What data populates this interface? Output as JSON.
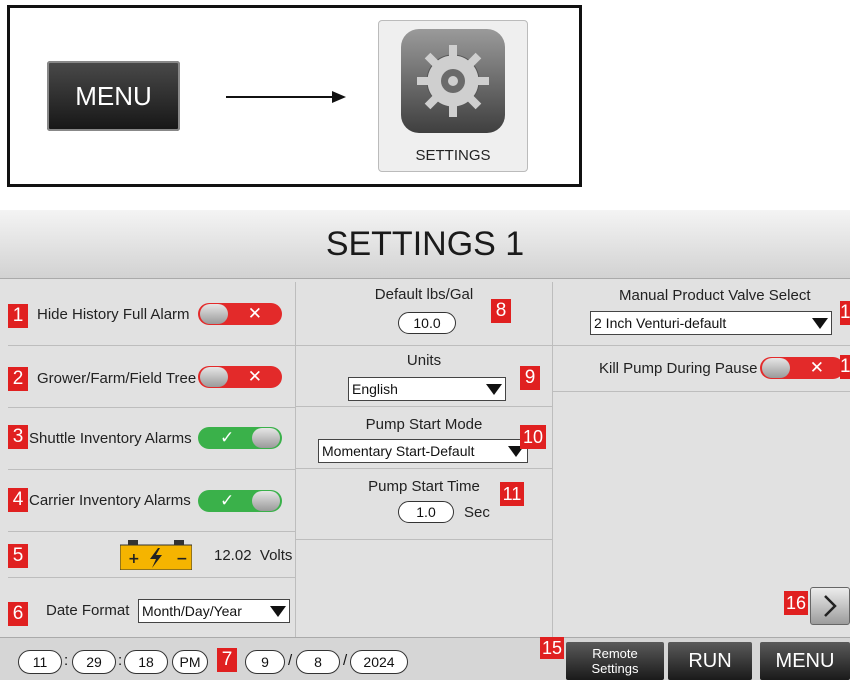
{
  "instruction": {
    "menu_label": "MENU",
    "settings_label": "SETTINGS",
    "icons": [
      "arrow-right-icon",
      "gear-icon"
    ]
  },
  "screen": {
    "title": "SETTINGS 1",
    "left": {
      "hide_history": {
        "badge": "1",
        "label": "Hide History Full Alarm",
        "state": "off"
      },
      "grower_tree": {
        "badge": "2",
        "label": "Grower/Farm/Field Tree",
        "state": "off"
      },
      "shuttle_alarms": {
        "badge": "3",
        "label": "Shuttle Inventory Alarms",
        "state": "on"
      },
      "carrier_alarms": {
        "badge": "4",
        "label": "Carrier Inventory Alarms",
        "state": "on"
      },
      "battery": {
        "badge": "5",
        "value": "12.02",
        "unit": "Volts"
      },
      "date_format": {
        "badge": "6",
        "label": "Date Format",
        "value": "Month/Day/Year"
      }
    },
    "middle": {
      "default_lbs": {
        "badge": "8",
        "label": "Default lbs/Gal",
        "value": "10.0"
      },
      "units": {
        "badge": "9",
        "label": "Units",
        "value": "English"
      },
      "pump_start_mode": {
        "badge": "10",
        "label": "Pump Start Mode",
        "value": "Momentary Start-Default"
      },
      "pump_start_time": {
        "badge": "11",
        "label": "Pump Start Time",
        "value": "1.0",
        "unit": "Sec"
      }
    },
    "right": {
      "valve_select": {
        "badge": "1",
        "label": "Manual Product Valve Select",
        "value": "2 Inch Venturi-default"
      },
      "kill_pump": {
        "badge": "1",
        "label": "Kill Pump During Pause",
        "state": "off"
      },
      "next_badge": "16"
    },
    "status": {
      "hour": "11",
      "minute": "29",
      "second": "18",
      "ampm": "PM",
      "time_badge": "7",
      "month": "9",
      "day": "8",
      "year": "2024",
      "colon": ":",
      "slash": "/",
      "remote_badge": "15",
      "remote_label_1": "Remote",
      "remote_label_2": "Settings",
      "run_label": "RUN",
      "menu_label": "MENU"
    }
  },
  "colors": {
    "badge": "#e02020",
    "toggle_off": "#e32a2a",
    "toggle_on": "#3ab14a",
    "battery": "#f5b400"
  }
}
